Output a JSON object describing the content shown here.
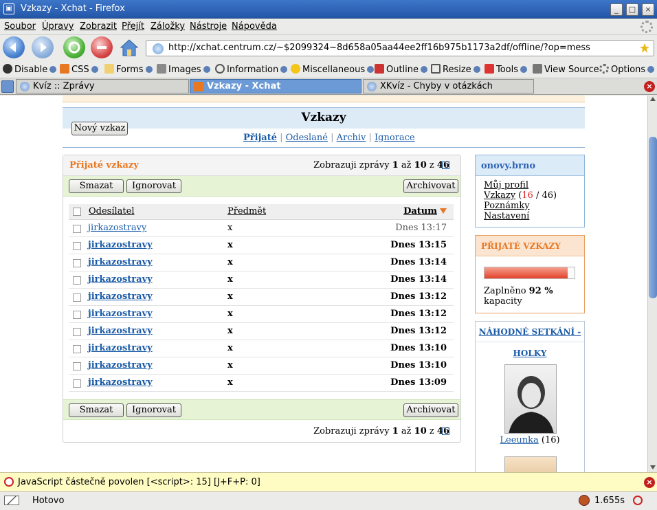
{
  "window": {
    "title": "Vzkazy - Xchat - Firefox"
  },
  "menu": [
    "Soubor",
    "Úpravy",
    "Zobrazit",
    "Přejít",
    "Záložky",
    "Nástroje",
    "Nápověda"
  ],
  "nav": {
    "url": "http://xchat.centrum.cz/~$2099324~8d658a05aa44ee2ff16b975b1173a2df/offline/?op=mess"
  },
  "toolbar": [
    "Disable",
    "CSS",
    "Forms",
    "Images",
    "Information",
    "Miscellaneous",
    "Outline",
    "Resize",
    "Tools",
    "View Source",
    "Options"
  ],
  "tabs": [
    "Kvíz :: Zprávy",
    "Vzkazy - Xchat",
    "XKvíz - Chyby v otázkách"
  ],
  "page": {
    "title": "Vzkazy",
    "new_button": "Nový vzkaz",
    "subnav": [
      "Přijaté",
      "Odeslané",
      "Archiv",
      "Ignorace"
    ],
    "panel_title": "Přijaté vzkazy",
    "paging": {
      "prefix": "Zobrazuji zprávy",
      "from": "1",
      "mid": "až",
      "to": "10",
      "of_word": "z",
      "total": "46"
    },
    "actions": {
      "delete": "Smazat",
      "ignore": "Ignorovat",
      "archive": "Archivovat"
    },
    "columns": {
      "sender": "Odesílatel",
      "subject": "Předmět",
      "date": "Datum"
    },
    "messages": [
      {
        "sender": "jirkazostravy",
        "subject": "x",
        "date": "Dnes 13:17",
        "unread": false
      },
      {
        "sender": "jirkazostravy",
        "subject": "x",
        "date": "Dnes 13:15",
        "unread": true
      },
      {
        "sender": "jirkazostravy",
        "subject": "x",
        "date": "Dnes 13:14",
        "unread": true
      },
      {
        "sender": "jirkazostravy",
        "subject": "x",
        "date": "Dnes 13:14",
        "unread": true
      },
      {
        "sender": "jirkazostravy",
        "subject": "x",
        "date": "Dnes 13:12",
        "unread": true
      },
      {
        "sender": "jirkazostravy",
        "subject": "x",
        "date": "Dnes 13:12",
        "unread": true
      },
      {
        "sender": "jirkazostravy",
        "subject": "x",
        "date": "Dnes 13:12",
        "unread": true
      },
      {
        "sender": "jirkazostravy",
        "subject": "x",
        "date": "Dnes 13:10",
        "unread": true
      },
      {
        "sender": "jirkazostravy",
        "subject": "x",
        "date": "Dnes 13:10",
        "unread": true
      },
      {
        "sender": "jirkazostravy",
        "subject": "x",
        "date": "Dnes 13:09",
        "unread": true
      }
    ]
  },
  "sidebar": {
    "user": "onovy.brno",
    "links": {
      "profile": "Můj profil",
      "messages": "Vzkazy",
      "msg_new": "16",
      "msg_sep": "/",
      "msg_total": "46",
      "notes": "Poznámky",
      "settings": "Nastavení"
    },
    "quota_title": "PŘIJATÉ VZKAZY",
    "quota_fraction": 0.92,
    "quota_label": "Zaplněno",
    "quota_value": "92 %",
    "quota_suffix": "kapacity",
    "meet_title_1": "NÁHODNÉ SETKÁNÍ -",
    "meet_title_2": "HOLKY",
    "meet_name": "Leeunka",
    "meet_age": "(16)"
  },
  "jsbar": {
    "text": "JavaScript částečně povolen [<script>: 15] [J+F+P: 0]"
  },
  "status": {
    "text": "Hotovo",
    "time": "1.655s"
  },
  "colors": {
    "accent_orange": "#e87722",
    "link_blue": "#1a5ba8",
    "title_blue": "#2f63b5"
  }
}
